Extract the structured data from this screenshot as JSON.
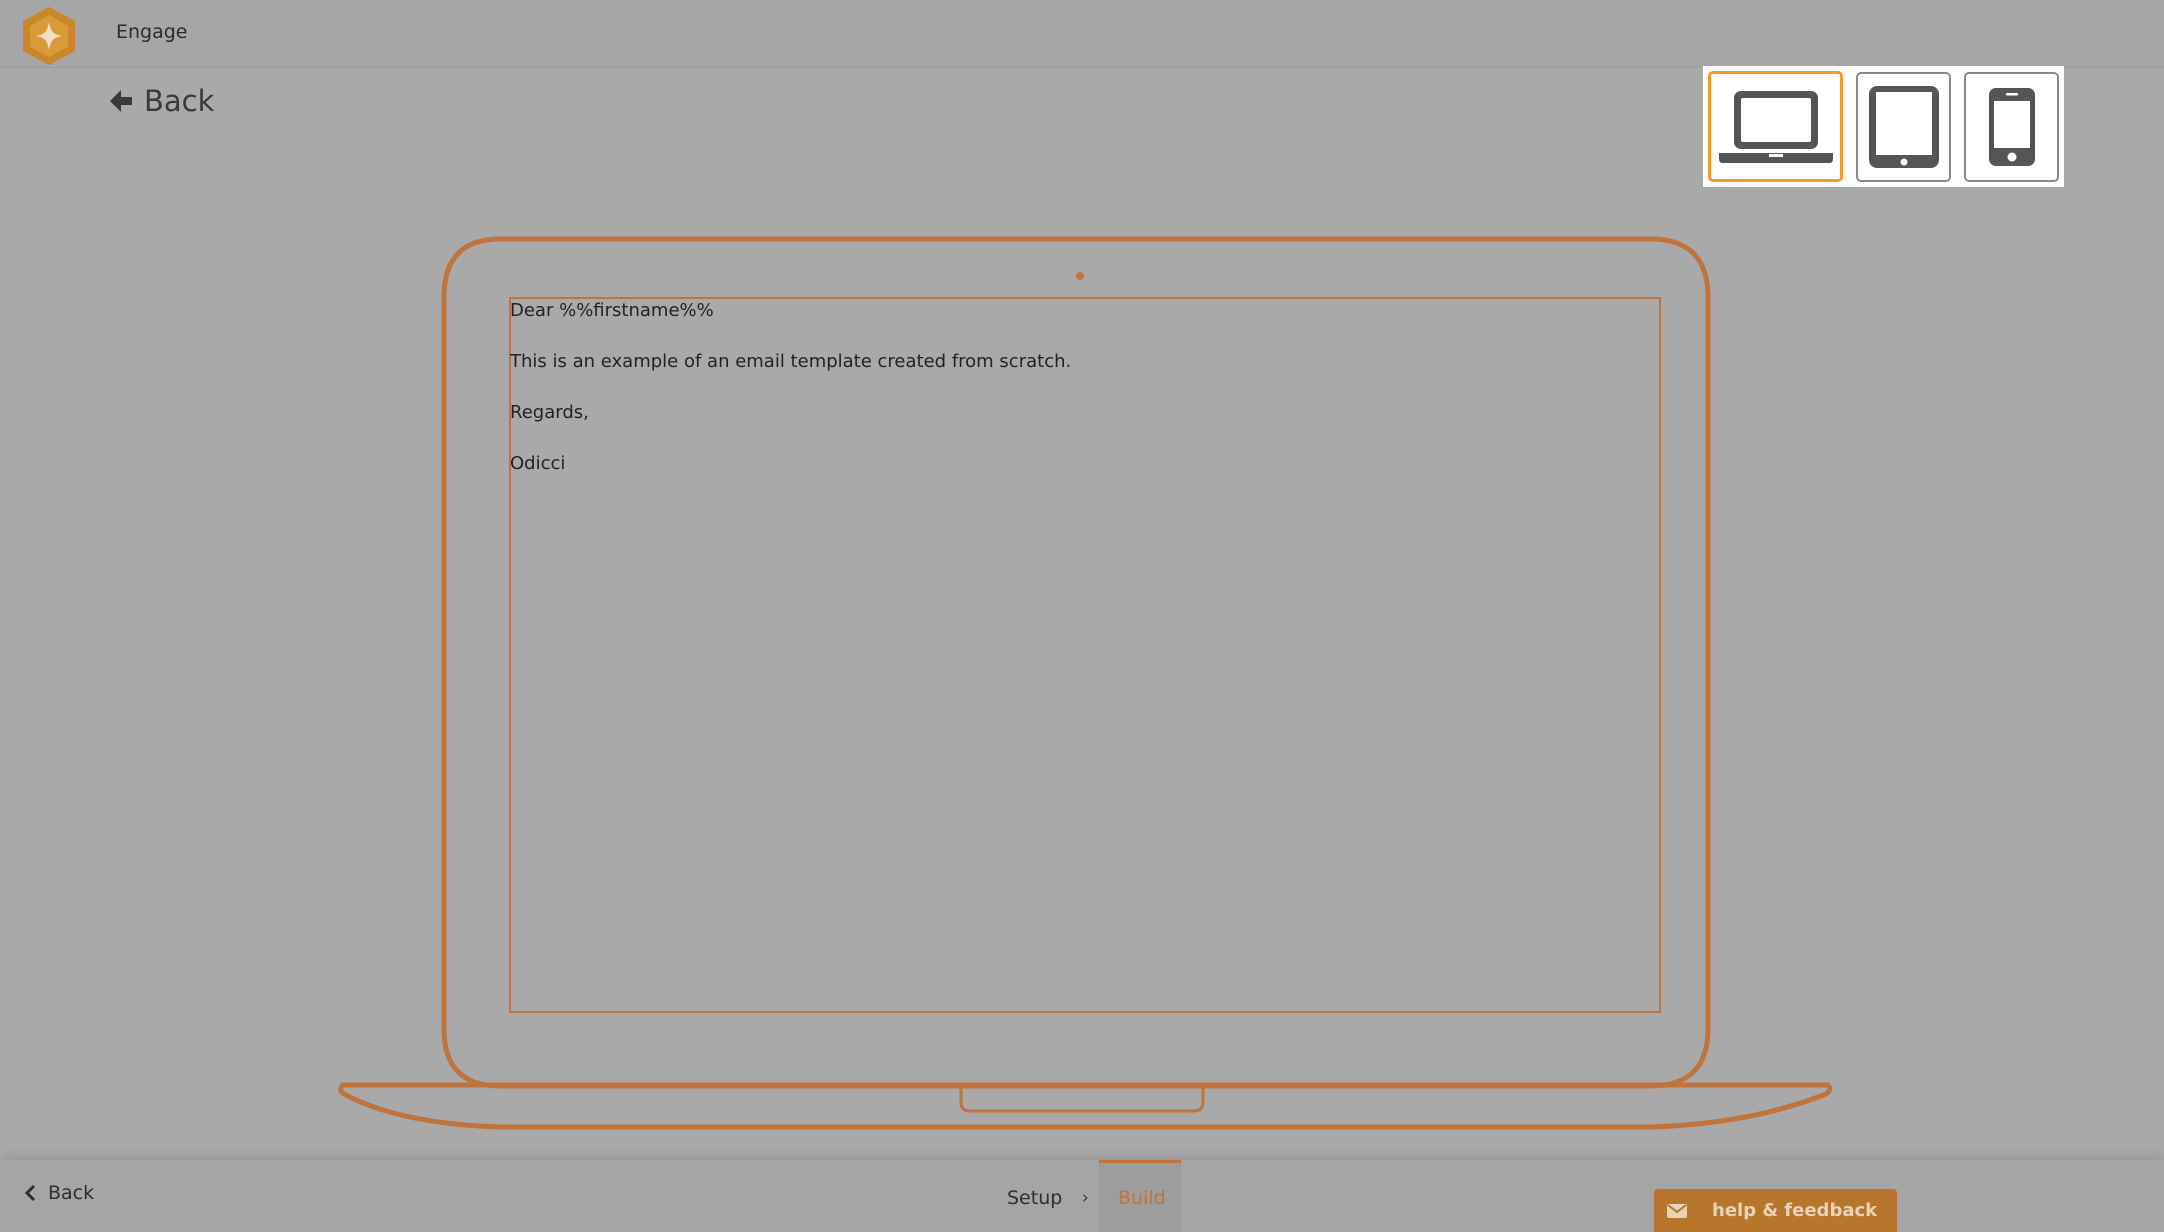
{
  "header": {
    "app_name": "Engage",
    "logo_icon": "hexagon-star-logo",
    "back_label": "Back"
  },
  "device_switcher": {
    "options": [
      {
        "name": "Desktop",
        "icon": "laptop-icon",
        "active": true
      },
      {
        "name": "Tablet",
        "icon": "tablet-icon",
        "active": false
      },
      {
        "name": "Mobile",
        "icon": "phone-icon",
        "active": false
      }
    ]
  },
  "email": {
    "lines": [
      "Dear %%firstname%%",
      "This is an example of an email template created from scratch.",
      "Regards,",
      "Odicci"
    ]
  },
  "footer": {
    "back_label": "Back",
    "steps": [
      {
        "label": "Setup",
        "active": false
      },
      {
        "label": "Build",
        "active": true
      }
    ],
    "step_separator": "›",
    "help_label": "help & feedback",
    "help_icon": "envelope-icon"
  },
  "colors": {
    "accent": "#c0733a",
    "active_border": "#f39a2c",
    "background": "#a9a9a9",
    "help_button": "#b8762d"
  }
}
